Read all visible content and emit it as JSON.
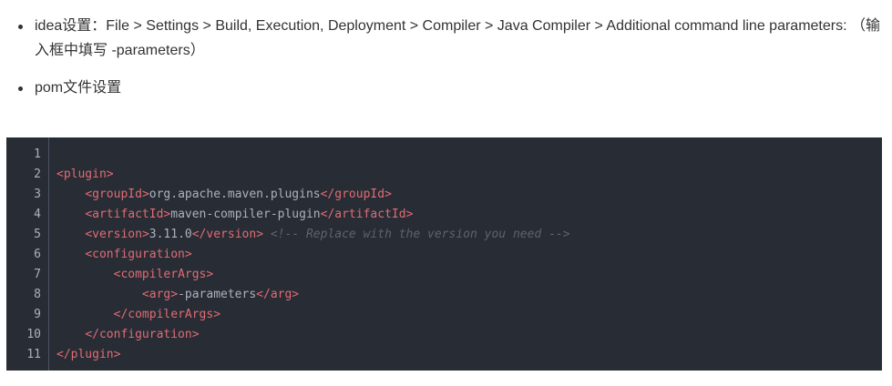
{
  "bullets": [
    {
      "line1": "idea设置：File > Settings > Build, Execution, Deployment > Compiler > Java Compiler > Additional command line parameters: （输",
      "line2": "入框中填写 -parameters）"
    },
    {
      "line1": "pom文件设置"
    }
  ],
  "code": {
    "language": "xml",
    "line_numbers": [
      "1",
      "2",
      "3",
      "4",
      "5",
      "6",
      "7",
      "8",
      "9",
      "10",
      "11"
    ],
    "lines": [
      {
        "indent": "",
        "open": "",
        "text": "",
        "close": "",
        "comment": ""
      },
      {
        "indent": "",
        "open": "plugin",
        "text": "",
        "close": "",
        "comment": ""
      },
      {
        "indent": "    ",
        "open": "groupId",
        "text": "org.apache.maven.plugins",
        "close": "groupId",
        "comment": ""
      },
      {
        "indent": "    ",
        "open": "artifactId",
        "text": "maven-compiler-plugin",
        "close": "artifactId",
        "comment": ""
      },
      {
        "indent": "    ",
        "open": "version",
        "text": "3.11.0",
        "close": "version",
        "comment": "<!-- Replace with the version you need -->"
      },
      {
        "indent": "    ",
        "open": "configuration",
        "text": "",
        "close": "",
        "comment": ""
      },
      {
        "indent": "        ",
        "open": "compilerArgs",
        "text": "",
        "close": "",
        "comment": ""
      },
      {
        "indent": "            ",
        "open": "arg",
        "text": "-parameters",
        "close": "arg",
        "comment": ""
      },
      {
        "indent": "        ",
        "open": "",
        "text": "",
        "close": "compilerArgs",
        "comment": ""
      },
      {
        "indent": "    ",
        "open": "",
        "text": "",
        "close": "configuration",
        "comment": ""
      },
      {
        "indent": "",
        "open": "",
        "text": "",
        "close": "plugin",
        "comment": ""
      }
    ]
  },
  "colors": {
    "code_background": "#282c34",
    "tag": "#e06c75",
    "text": "#abb2bf",
    "comment": "#5c6370"
  }
}
